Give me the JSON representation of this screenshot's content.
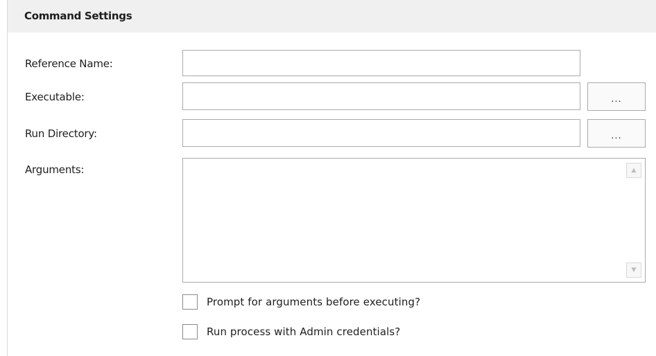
{
  "section": {
    "title": "Command Settings"
  },
  "fields": {
    "reference_name": {
      "label": "Reference Name:",
      "value": "",
      "placeholder": ""
    },
    "executable": {
      "label": "Executable:",
      "value": "",
      "placeholder": "",
      "browse_label": "..."
    },
    "run_directory": {
      "label": "Run Directory:",
      "value": "",
      "placeholder": "",
      "browse_label": "..."
    },
    "arguments": {
      "label": "Arguments:",
      "value": ""
    }
  },
  "scrollbar": {
    "up_icon": "▲",
    "down_icon": "▼"
  },
  "options": {
    "prompt_for_arguments": {
      "label": "Prompt for arguments before executing?",
      "checked": false
    },
    "run_as_admin": {
      "label": "Run process with Admin credentials?",
      "checked": false
    }
  }
}
